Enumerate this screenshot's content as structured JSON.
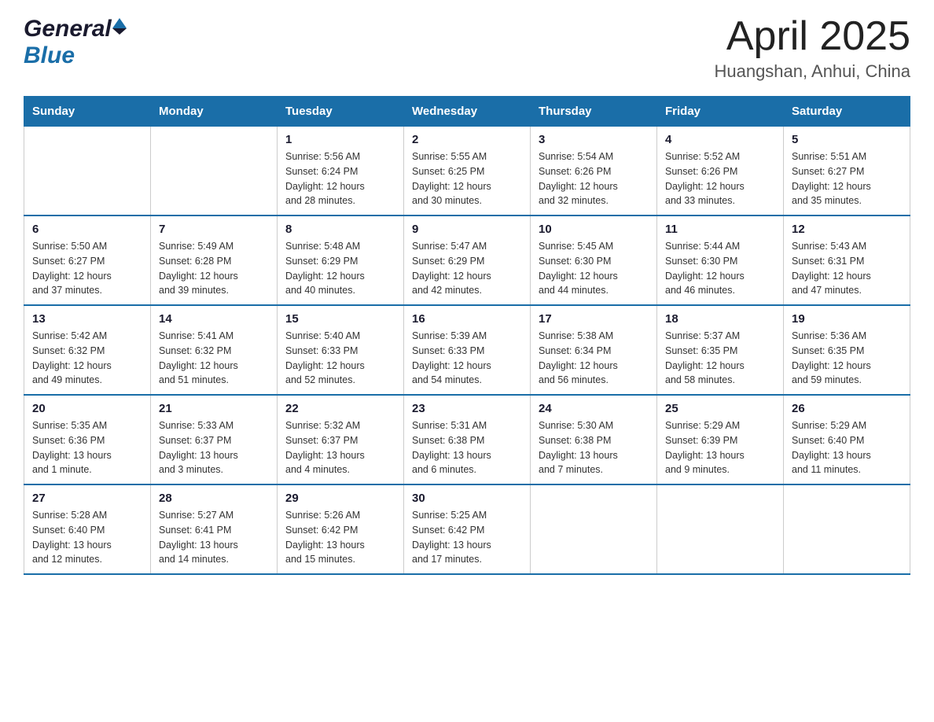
{
  "header": {
    "logo_general": "General",
    "logo_blue": "Blue",
    "month_title": "April 2025",
    "location": "Huangshan, Anhui, China"
  },
  "calendar": {
    "days_of_week": [
      "Sunday",
      "Monday",
      "Tuesday",
      "Wednesday",
      "Thursday",
      "Friday",
      "Saturday"
    ],
    "weeks": [
      [
        {
          "day": "",
          "info": ""
        },
        {
          "day": "",
          "info": ""
        },
        {
          "day": "1",
          "info": "Sunrise: 5:56 AM\nSunset: 6:24 PM\nDaylight: 12 hours\nand 28 minutes."
        },
        {
          "day": "2",
          "info": "Sunrise: 5:55 AM\nSunset: 6:25 PM\nDaylight: 12 hours\nand 30 minutes."
        },
        {
          "day": "3",
          "info": "Sunrise: 5:54 AM\nSunset: 6:26 PM\nDaylight: 12 hours\nand 32 minutes."
        },
        {
          "day": "4",
          "info": "Sunrise: 5:52 AM\nSunset: 6:26 PM\nDaylight: 12 hours\nand 33 minutes."
        },
        {
          "day": "5",
          "info": "Sunrise: 5:51 AM\nSunset: 6:27 PM\nDaylight: 12 hours\nand 35 minutes."
        }
      ],
      [
        {
          "day": "6",
          "info": "Sunrise: 5:50 AM\nSunset: 6:27 PM\nDaylight: 12 hours\nand 37 minutes."
        },
        {
          "day": "7",
          "info": "Sunrise: 5:49 AM\nSunset: 6:28 PM\nDaylight: 12 hours\nand 39 minutes."
        },
        {
          "day": "8",
          "info": "Sunrise: 5:48 AM\nSunset: 6:29 PM\nDaylight: 12 hours\nand 40 minutes."
        },
        {
          "day": "9",
          "info": "Sunrise: 5:47 AM\nSunset: 6:29 PM\nDaylight: 12 hours\nand 42 minutes."
        },
        {
          "day": "10",
          "info": "Sunrise: 5:45 AM\nSunset: 6:30 PM\nDaylight: 12 hours\nand 44 minutes."
        },
        {
          "day": "11",
          "info": "Sunrise: 5:44 AM\nSunset: 6:30 PM\nDaylight: 12 hours\nand 46 minutes."
        },
        {
          "day": "12",
          "info": "Sunrise: 5:43 AM\nSunset: 6:31 PM\nDaylight: 12 hours\nand 47 minutes."
        }
      ],
      [
        {
          "day": "13",
          "info": "Sunrise: 5:42 AM\nSunset: 6:32 PM\nDaylight: 12 hours\nand 49 minutes."
        },
        {
          "day": "14",
          "info": "Sunrise: 5:41 AM\nSunset: 6:32 PM\nDaylight: 12 hours\nand 51 minutes."
        },
        {
          "day": "15",
          "info": "Sunrise: 5:40 AM\nSunset: 6:33 PM\nDaylight: 12 hours\nand 52 minutes."
        },
        {
          "day": "16",
          "info": "Sunrise: 5:39 AM\nSunset: 6:33 PM\nDaylight: 12 hours\nand 54 minutes."
        },
        {
          "day": "17",
          "info": "Sunrise: 5:38 AM\nSunset: 6:34 PM\nDaylight: 12 hours\nand 56 minutes."
        },
        {
          "day": "18",
          "info": "Sunrise: 5:37 AM\nSunset: 6:35 PM\nDaylight: 12 hours\nand 58 minutes."
        },
        {
          "day": "19",
          "info": "Sunrise: 5:36 AM\nSunset: 6:35 PM\nDaylight: 12 hours\nand 59 minutes."
        }
      ],
      [
        {
          "day": "20",
          "info": "Sunrise: 5:35 AM\nSunset: 6:36 PM\nDaylight: 13 hours\nand 1 minute."
        },
        {
          "day": "21",
          "info": "Sunrise: 5:33 AM\nSunset: 6:37 PM\nDaylight: 13 hours\nand 3 minutes."
        },
        {
          "day": "22",
          "info": "Sunrise: 5:32 AM\nSunset: 6:37 PM\nDaylight: 13 hours\nand 4 minutes."
        },
        {
          "day": "23",
          "info": "Sunrise: 5:31 AM\nSunset: 6:38 PM\nDaylight: 13 hours\nand 6 minutes."
        },
        {
          "day": "24",
          "info": "Sunrise: 5:30 AM\nSunset: 6:38 PM\nDaylight: 13 hours\nand 7 minutes."
        },
        {
          "day": "25",
          "info": "Sunrise: 5:29 AM\nSunset: 6:39 PM\nDaylight: 13 hours\nand 9 minutes."
        },
        {
          "day": "26",
          "info": "Sunrise: 5:29 AM\nSunset: 6:40 PM\nDaylight: 13 hours\nand 11 minutes."
        }
      ],
      [
        {
          "day": "27",
          "info": "Sunrise: 5:28 AM\nSunset: 6:40 PM\nDaylight: 13 hours\nand 12 minutes."
        },
        {
          "day": "28",
          "info": "Sunrise: 5:27 AM\nSunset: 6:41 PM\nDaylight: 13 hours\nand 14 minutes."
        },
        {
          "day": "29",
          "info": "Sunrise: 5:26 AM\nSunset: 6:42 PM\nDaylight: 13 hours\nand 15 minutes."
        },
        {
          "day": "30",
          "info": "Sunrise: 5:25 AM\nSunset: 6:42 PM\nDaylight: 13 hours\nand 17 minutes."
        },
        {
          "day": "",
          "info": ""
        },
        {
          "day": "",
          "info": ""
        },
        {
          "day": "",
          "info": ""
        }
      ]
    ]
  }
}
